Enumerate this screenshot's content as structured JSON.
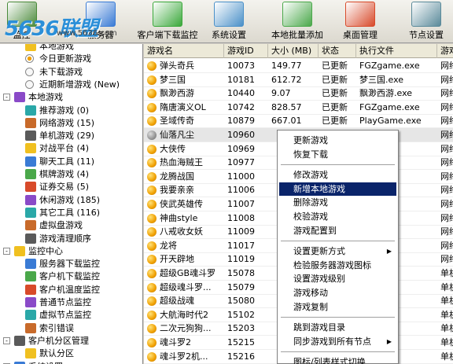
{
  "logo": {
    "text": "5636联盟",
    "sub": "www.5636.com"
  },
  "toolbar": {
    "items": [
      {
        "label": "监控",
        "icon": "monitor-icon",
        "color": "#4a8a3a"
      },
      {
        "label": "服务器",
        "icon": "server-download-icon",
        "color": "#3a7bd5"
      },
      {
        "label": "客户端下载监控",
        "icon": "client-download-icon",
        "color": "#3aa83a"
      },
      {
        "label": "系统设置",
        "icon": "settings-icon",
        "color": "#4a90c8"
      },
      {
        "label": "本地批量添加",
        "icon": "batch-add-icon",
        "color": "#4aa84a"
      },
      {
        "label": "桌面管理",
        "icon": "desktop-icon",
        "color": "#d84a2a"
      },
      {
        "label": "节点设置",
        "icon": "node-icon",
        "color": "#5a8a9a"
      }
    ]
  },
  "tree": {
    "items": [
      {
        "label": "本地游戏",
        "icon": "home-icon",
        "level": 2
      },
      {
        "label": "今日更新游戏",
        "icon": "radio-icon",
        "level": 2
      },
      {
        "label": "未下载游戏",
        "icon": "radio-icon",
        "level": 2
      },
      {
        "label": "近期新增游戏 (New)",
        "icon": "radio-icon",
        "level": 2
      },
      {
        "label": "本地游戏",
        "icon": "group-icon",
        "level": 1,
        "expand": "-"
      },
      {
        "label": "推荐游戏 (0)",
        "icon": "star-icon",
        "level": 2
      },
      {
        "label": "网络游戏 (15)",
        "icon": "globe-icon",
        "level": 2
      },
      {
        "label": "单机游戏 (29)",
        "icon": "joystick-icon",
        "level": 2
      },
      {
        "label": "对战平台 (4)",
        "icon": "battle-icon",
        "level": 2
      },
      {
        "label": "聊天工具 (11)",
        "icon": "chat-icon",
        "level": 2
      },
      {
        "label": "棋牌游戏 (4)",
        "icon": "cards-icon",
        "level": 2
      },
      {
        "label": "证券交易 (5)",
        "icon": "stock-icon",
        "level": 2
      },
      {
        "label": "休闲游戏 (185)",
        "icon": "piano-icon",
        "level": 2
      },
      {
        "label": "其它工具 (116)",
        "icon": "tools-icon",
        "level": 2
      },
      {
        "label": "虚拟盘游戏",
        "icon": "disk-icon",
        "level": 2
      },
      {
        "label": "游戏清理顺序",
        "icon": "sort-icon",
        "level": 2
      },
      {
        "label": "监控中心",
        "icon": "monitor-group-icon",
        "level": 1,
        "expand": "-"
      },
      {
        "label": "服务器下载监控",
        "icon": "down-arrow-icon",
        "level": 2
      },
      {
        "label": "客户机下载监控",
        "icon": "down-arrow-icon",
        "level": 2
      },
      {
        "label": "客户机温度监控",
        "icon": "thermo-icon",
        "level": 2
      },
      {
        "label": "普通节点监控",
        "icon": "node-icon",
        "level": 2
      },
      {
        "label": "虚拟节点监控",
        "icon": "vnode-icon",
        "level": 2
      },
      {
        "label": "索引错误",
        "icon": "error-icon",
        "level": 2
      },
      {
        "label": "客户机分区管理",
        "icon": "partition-group-icon",
        "level": 1,
        "expand": "-"
      },
      {
        "label": "默认分区",
        "icon": "partition-icon",
        "level": 2
      },
      {
        "label": "系统设置",
        "icon": "gear-icon",
        "level": 1,
        "expand": "+"
      }
    ]
  },
  "table": {
    "columns": [
      "游戏名",
      "游戏ID",
      "大小 (MB)",
      "状态",
      "执行文件",
      "游戏"
    ],
    "rows": [
      [
        "弹头奇兵",
        "10073",
        "149.77",
        "已更新",
        "FGZgame.exe",
        "网络"
      ],
      [
        "梦三国",
        "10181",
        "612.72",
        "已更新",
        "梦三国.exe",
        "网络"
      ],
      [
        "飘渺西游",
        "10440",
        "9.07",
        "已更新",
        "飘渺西游.exe",
        "网络"
      ],
      [
        "隋唐演义OL",
        "10742",
        "828.57",
        "已更新",
        "FGZgame.exe",
        "网络"
      ],
      [
        "圣域传奇",
        "10879",
        "667.01",
        "已更新",
        "PlayGame.exe",
        "网络"
      ],
      [
        "仙落凡尘",
        "10960",
        "",
        "",
        "xxx.exe",
        "网络"
      ],
      [
        "大侠传",
        "10969",
        "",
        "",
        ".exe",
        "网络"
      ],
      [
        "热血海贼王",
        "10977",
        "",
        "",
        "王.exe",
        "网络"
      ],
      [
        "龙腾战国",
        "11000",
        "",
        "",
        ".exe",
        "网络"
      ],
      [
        "我要亲亲",
        "11006",
        "",
        "",
        ".exe",
        "网络"
      ],
      [
        "侠武英雄传",
        "11007",
        "",
        "",
        ".exe",
        "网络"
      ],
      [
        "神曲style",
        "11008",
        "",
        "",
        "e.exe",
        "网络"
      ],
      [
        "八戒收女妖",
        "11009",
        "",
        "",
        "xe",
        "网络"
      ],
      [
        "龙将",
        "11017",
        "",
        "",
        "xe",
        "网络"
      ],
      [
        "开天辟地",
        "11019",
        "",
        "",
        "",
        "网络"
      ],
      [
        "超级GB魂斗罗",
        "15078",
        "",
        "",
        "",
        "单机"
      ],
      [
        "超级魂斗罗...",
        "15079",
        "",
        "",
        "",
        "单机"
      ],
      [
        "超级战魂",
        "15080",
        "",
        "",
        "",
        "单机"
      ],
      [
        "大航海时代2",
        "15102",
        "",
        "",
        "",
        "单机"
      ],
      [
        "二次元狗狗...",
        "15203",
        "",
        "",
        "",
        "单机"
      ],
      [
        "魂斗罗2",
        "15215",
        "",
        "",
        "",
        "单机"
      ],
      [
        "魂斗罗2机...",
        "15216",
        "",
        "",
        "",
        "单机"
      ],
      [
        "魂斗罗2美版",
        "15217",
        "",
        "",
        "",
        "单机"
      ]
    ]
  },
  "context_menu": {
    "items": [
      {
        "label": "更新游戏"
      },
      {
        "label": "恢复下载"
      },
      {
        "sep": true
      },
      {
        "label": "修改游戏"
      },
      {
        "label": "新增本地游戏",
        "highlight": true
      },
      {
        "label": "删除游戏"
      },
      {
        "label": "校验游戏"
      },
      {
        "label": "游戏配置到"
      },
      {
        "sep": true
      },
      {
        "label": "设置更新方式",
        "submenu": true
      },
      {
        "label": "检验服务器游戏图标"
      },
      {
        "label": "设置游戏级别"
      },
      {
        "label": "游戏移动"
      },
      {
        "label": "游戏复制"
      },
      {
        "sep": true
      },
      {
        "label": "跳到游戏目录"
      },
      {
        "label": "同步游戏到所有节点",
        "submenu": true
      },
      {
        "sep": true
      },
      {
        "label": "图标/列表样式切换"
      }
    ]
  }
}
